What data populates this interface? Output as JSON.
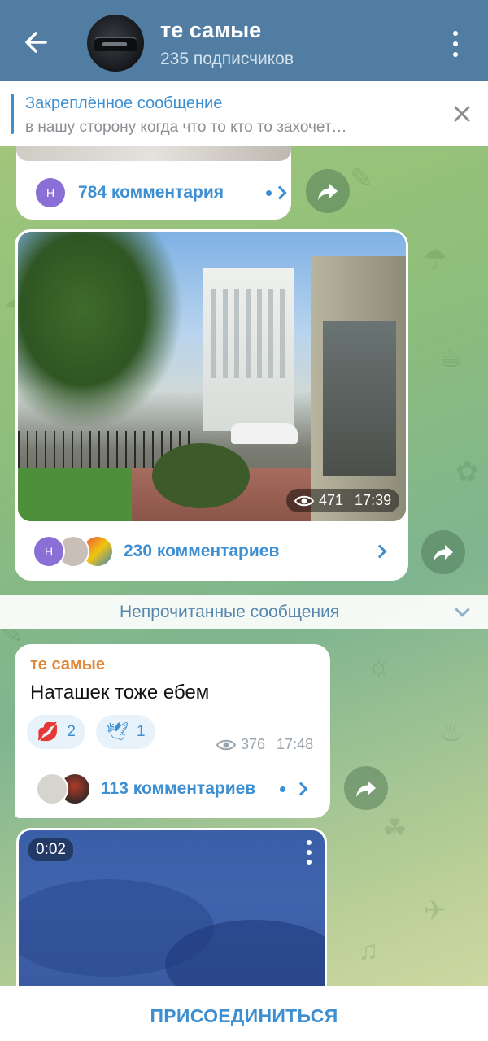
{
  "header": {
    "title": "те самые",
    "subtitle": "235 подписчиков",
    "back_icon": "arrow-left-icon",
    "menu_icon": "more-vertical-icon"
  },
  "pinned": {
    "title": "Закреплённое сообщение",
    "text": "в нашу сторону когда что то кто то захочет…",
    "close_icon": "close-icon"
  },
  "post1": {
    "comment_avatar_letter": "Н",
    "comments": "784 комментария"
  },
  "post2": {
    "views": "471",
    "time": "17:39",
    "comment_avatar_letter": "Н",
    "comments": "230 комментариев"
  },
  "unread_divider": "Непрочитанные сообщения",
  "post3": {
    "author": "те самые",
    "text": "Наташек тоже ебем",
    "reactions": [
      {
        "emoji": "💋",
        "count": "2"
      },
      {
        "emoji": "🕊",
        "count": "1"
      }
    ],
    "views": "376",
    "time": "17:48",
    "comments": "113 комментариев"
  },
  "post4": {
    "duration": "0:02"
  },
  "join_label": "ПРИСОЕДИНИТЬСЯ",
  "colors": {
    "header": "#517da2",
    "accent": "#3d8fd1",
    "author": "#e0883a"
  }
}
